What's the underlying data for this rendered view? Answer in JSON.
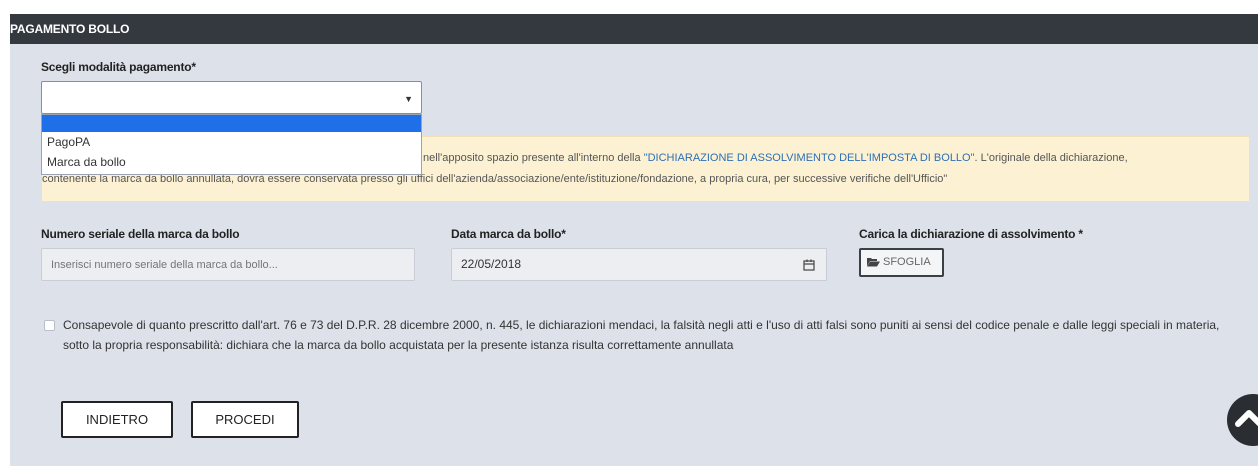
{
  "section": {
    "title": "PAGAMENTO BOLLO"
  },
  "payment_mode": {
    "label": "Scegli modalità pagamento*",
    "selected": "",
    "options": [
      "",
      "PagoPA",
      "Marca da bollo"
    ]
  },
  "notice": {
    "line1_prefix": "nell'apposito spazio presente all'interno della ",
    "line1_link": "\"DICHIARAZIONE DI ASSOLVIMENTO DELL'IMPOSTA DI BOLLO\"",
    "line1_suffix": ". L'originale della dichiarazione,",
    "line2": "contenente la marca da bollo annullata, dovrà essere conservata presso gli uffici dell'azienda/associazione/ente/istituzione/fondazione, a propria cura, per successive verifiche dell'Ufficio\""
  },
  "serial": {
    "label": "Numero seriale della marca da bollo",
    "value": "",
    "placeholder": "Inserisci numero seriale della marca da bollo..."
  },
  "date": {
    "label": "Data marca da bollo*",
    "value": "22/05/2018"
  },
  "upload": {
    "label": "Carica la dichiarazione di assolvimento *",
    "button": "SFOGLIA"
  },
  "declaration": {
    "checked": false,
    "text": "Consapevole di quanto prescritto dall'art. 76 e 73 del D.P.R. 28 dicembre 2000, n. 445, le dichiarazioni mendaci, la falsità negli atti e l'uso di atti falsi sono puniti ai sensi del codice penale e dalle leggi speciali in materia, sotto la propria responsabilità: dichiara che la marca da bollo acquistata per la presente istanza risulta correttamente annullata"
  },
  "actions": {
    "back": "INDIETRO",
    "next": "PROCEDI"
  },
  "icons": {
    "dropdown": "chevron-down-icon",
    "calendar": "calendar-icon",
    "folder": "folder-open-icon",
    "scroll_top": "chevron-up-icon"
  },
  "colors": {
    "header_bg": "#34383f",
    "panel_bg": "#dde2ea",
    "notice_bg": "#fcf1d3",
    "link": "#2e6fb5",
    "option_highlight": "#1e6fe8"
  }
}
